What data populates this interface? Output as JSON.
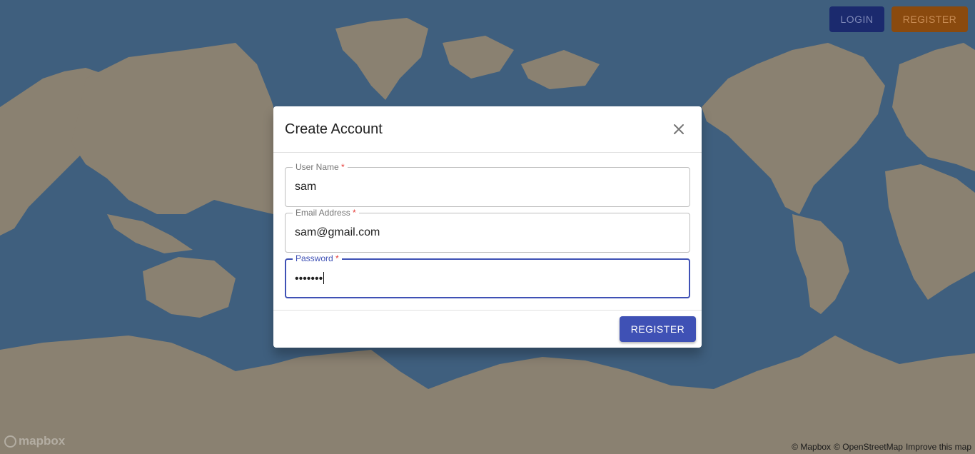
{
  "topbar": {
    "login_label": "LOGIN",
    "register_label": "REGISTER"
  },
  "dialog": {
    "title": "Create Account",
    "close_icon": "close-icon",
    "fields": [
      {
        "label": "User Name",
        "required": "*",
        "value": "sam"
      },
      {
        "label": "Email Address",
        "required": "*",
        "value": "sam@gmail.com"
      },
      {
        "label": "Password",
        "required": "*",
        "value": "•••••••"
      }
    ],
    "submit_label": "REGISTER"
  },
  "map": {
    "logo_text": "mapbox",
    "attribution": [
      "© Mapbox",
      "© OpenStreetMap",
      "Improve this map"
    ]
  },
  "colors": {
    "ocean": "#3f5f7e",
    "land": "#8a8171",
    "primary": "#3f51b5",
    "login_bg": "#1b2a6e",
    "register_top_bg": "#8a4a0e"
  }
}
